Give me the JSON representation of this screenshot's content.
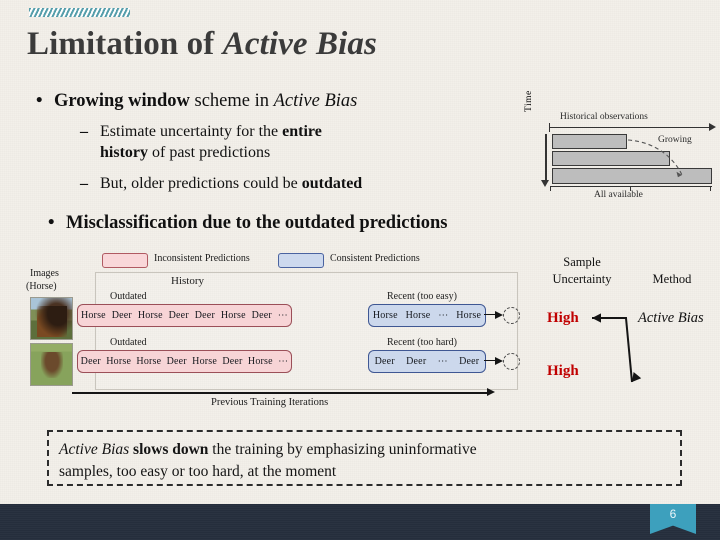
{
  "slide": {
    "number": "6",
    "title_plain": "Limitation of ",
    "title_italic": "Active Bias"
  },
  "body": {
    "bullet1": {
      "bullet_char": "•",
      "bold_lead": "Growing window",
      "rest": " scheme in ",
      "italic_tail": "Active Bias"
    },
    "sub1": {
      "dash": "–",
      "text_a": "Estimate uncertainty for the ",
      "bold_a": "entire",
      "bold_b": "history",
      "text_b": " of past predictions"
    },
    "sub2": {
      "dash": "–",
      "text": "But, older predictions could be ",
      "bold": "outdated"
    },
    "bullet2": {
      "bullet_char": "•",
      "text": "Misclassification due to the outdated predictions"
    }
  },
  "growing_window_figure": {
    "top_label": "Historical observations",
    "side_label": "Time",
    "growing_label": "Growing",
    "bottom_label": "All available",
    "bars": [
      {
        "width_pct": 46
      },
      {
        "width_pct": 73
      },
      {
        "width_pct": 100
      }
    ]
  },
  "main_figure": {
    "legend": [
      {
        "swatch": "pink",
        "label": "Inconsistent Predictions"
      },
      {
        "swatch": "blue",
        "label": "Consistent Predictions"
      }
    ],
    "images_label_line1": "Images",
    "images_label_line2": "(Horse)",
    "history_label": "History",
    "axis_label": "Previous Training Iterations",
    "rows": [
      {
        "history_caption": "Outdated",
        "history_tokens": [
          "Horse",
          "Deer",
          "Horse",
          "Deer",
          "Deer",
          "Horse",
          "Deer",
          "⋯"
        ],
        "recent_caption": "Recent (too easy)",
        "recent_tokens": [
          "Horse",
          "Horse",
          "⋯",
          "Horse"
        ]
      },
      {
        "history_caption": "Outdated",
        "history_tokens": [
          "Deer",
          "Horse",
          "Horse",
          "Deer",
          "Horse",
          "Deer",
          "Horse",
          "⋯"
        ],
        "recent_caption": "Recent (too hard)",
        "recent_tokens": [
          "Deer",
          "Deer",
          "⋯",
          "Deer"
        ]
      }
    ]
  },
  "right_panel": {
    "header_uncertainty_line1": "Sample",
    "header_uncertainty_line2": "Uncertainty",
    "header_method": "Method",
    "value_row1": "High",
    "value_row2": "High",
    "method_name": "Active Bias",
    "high_color": "#c00000"
  },
  "callout": {
    "italic_lead": "Active Bias",
    "bold_phrase": "slows down",
    "text_mid": " the training by emphasizing uninformative",
    "text_end": "samples, too easy or too hard, at the moment"
  },
  "theme": {
    "background": "#f3f0ea",
    "title_color": "#3b3b3b",
    "accent_teal": "#3da0bd",
    "footer_navy": "#262f3d"
  }
}
